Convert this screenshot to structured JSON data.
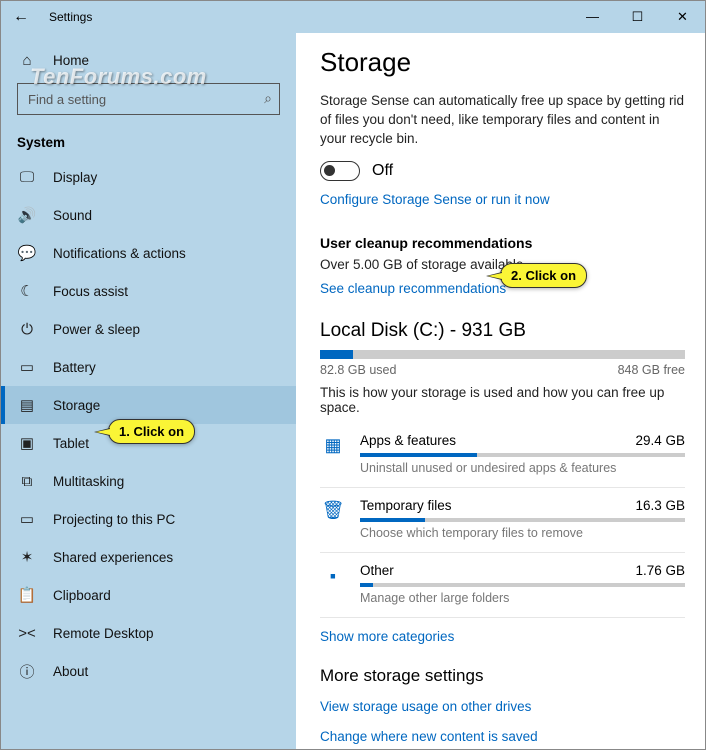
{
  "window": {
    "title": "Settings"
  },
  "watermark": "TenForums.com",
  "sidebar": {
    "home": "Home",
    "search_placeholder": "Find a setting",
    "heading": "System",
    "items": [
      {
        "label": "Display"
      },
      {
        "label": "Sound"
      },
      {
        "label": "Notifications & actions"
      },
      {
        "label": "Focus assist"
      },
      {
        "label": "Power & sleep"
      },
      {
        "label": "Battery"
      },
      {
        "label": "Storage",
        "selected": true
      },
      {
        "label": "Tablet"
      },
      {
        "label": "Multitasking"
      },
      {
        "label": "Projecting to this PC"
      },
      {
        "label": "Shared experiences"
      },
      {
        "label": "Clipboard"
      },
      {
        "label": "Remote Desktop"
      },
      {
        "label": "About"
      }
    ]
  },
  "main": {
    "title": "Storage",
    "sense_desc": "Storage Sense can automatically free up space by getting rid of files you don't need, like temporary files and content in your recycle bin.",
    "toggle_label": "Off",
    "configure_link": "Configure Storage Sense or run it now",
    "cleanup_heading": "User cleanup recommendations",
    "cleanup_sub": "Over 5.00 GB of storage available.",
    "cleanup_link": "See cleanup recommendations",
    "disk_title": "Local Disk (C:) - 931 GB",
    "disk_used": "82.8 GB used",
    "disk_free": "848 GB free",
    "disk_fill_pct": 9,
    "disk_desc": "This is how your storage is used and how you can free up space.",
    "categories": [
      {
        "name": "Apps & features",
        "size": "29.4 GB",
        "hint": "Uninstall unused or undesired apps & features",
        "fill": 36
      },
      {
        "name": "Temporary files",
        "size": "16.3 GB",
        "hint": "Choose which temporary files to remove",
        "fill": 20
      },
      {
        "name": "Other",
        "size": "1.76 GB",
        "hint": "Manage other large folders",
        "fill": 4
      }
    ],
    "show_more": "Show more categories",
    "more_heading": "More storage settings",
    "more_link1": "View storage usage on other drives",
    "more_link2": "Change where new content is saved"
  },
  "callouts": {
    "c1": "1. Click on",
    "c2": "2. Click on"
  }
}
